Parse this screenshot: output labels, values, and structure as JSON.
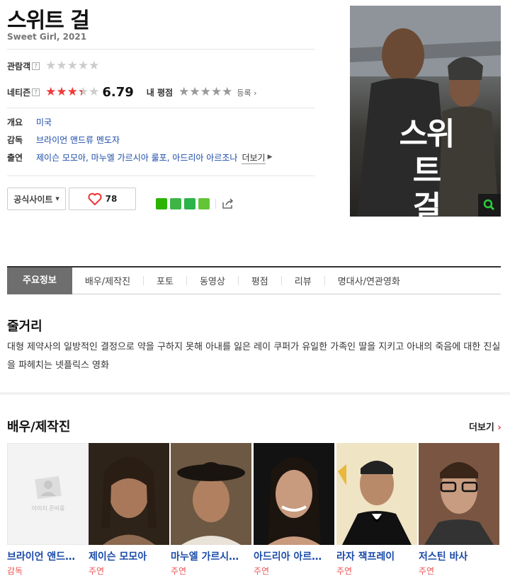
{
  "movie": {
    "title": "스위트 걸",
    "subtitle": "Sweet Girl, 2021"
  },
  "ratings": {
    "audience_label": "관람객",
    "netizen_label": "네티즌",
    "netizen_score": "6.79",
    "netizen_score_value": 6.79,
    "my_rating_label": "내 평점",
    "register_label": "등록",
    "help_mark": "?"
  },
  "info": {
    "overview_label": "개요",
    "overview_value": "미국",
    "director_label": "감독",
    "director_value": "브라이언 앤드류 멘도자",
    "cast_label": "출연",
    "cast_value": "제이슨 모모아, 마누엘 가르시아 룰포, 아드리아 아르조나",
    "more_label": "더보기"
  },
  "actions": {
    "site_label": "공식사이트",
    "like_count": "78"
  },
  "poster": {
    "title_line1": "스위트",
    "title_line2": "걸"
  },
  "tabs": [
    {
      "label": "주요정보"
    },
    {
      "label": "배우/제작진"
    },
    {
      "label": "포토"
    },
    {
      "label": "동영상"
    },
    {
      "label": "평점"
    },
    {
      "label": "리뷰"
    },
    {
      "label": "명대사/연관영화"
    }
  ],
  "synopsis": {
    "title": "줄거리",
    "text": "대형 제약사의 일방적인 결정으로 약을 구하지 못해 아내를 잃은 레이 쿠퍼가 유일한 가족인 딸을 지키고 아내의 죽음에 대한 진실을 파헤치는 넷플릭스 영화"
  },
  "cast_section": {
    "title": "배우/제작진",
    "more_label": "더보기",
    "placeholder_text": "이미지 준비중",
    "members": [
      {
        "name": "브라이언 앤드…",
        "role": "감독"
      },
      {
        "name": "제이슨 모모아",
        "role": "주연"
      },
      {
        "name": "마누엘 가르시…",
        "role": "주연"
      },
      {
        "name": "아드리아 아르…",
        "role": "주연"
      },
      {
        "name": "라자 잭프레이",
        "role": "주연"
      },
      {
        "name": "저스틴 바사",
        "role": "주연"
      }
    ]
  },
  "colors": {
    "link": "#1a4aa8",
    "star_red": "#ee3a3a",
    "role_red": "#e55"
  }
}
